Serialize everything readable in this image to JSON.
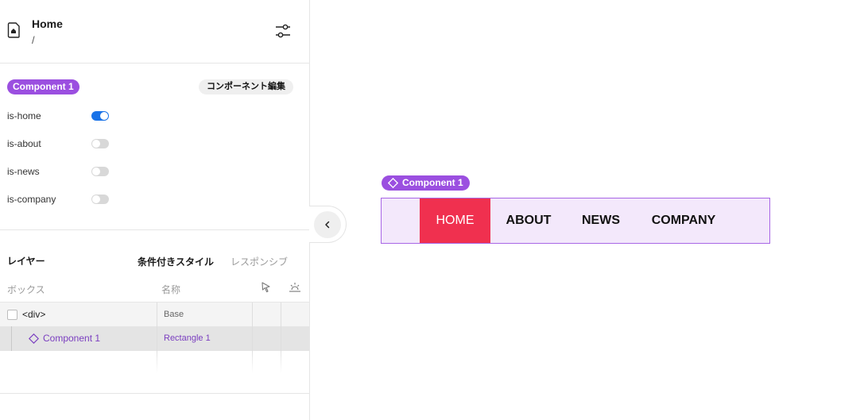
{
  "header": {
    "title": "Home",
    "path": "/"
  },
  "component": {
    "badge": "Component 1",
    "edit_label": "コンポーネント編集",
    "props": [
      {
        "label": "is-home",
        "on": true
      },
      {
        "label": "is-about",
        "on": false
      },
      {
        "label": "is-news",
        "on": false
      },
      {
        "label": "is-company",
        "on": false
      }
    ]
  },
  "layers": {
    "title": "レイヤー",
    "tab_conditional": "条件付きスタイル",
    "tab_responsive": "レスポンシブ",
    "col_box": "ボックス",
    "col_name": "名称",
    "rows": [
      {
        "name": "<div>",
        "value": "Base"
      },
      {
        "name": "Component 1",
        "value": "Rectangle 1"
      }
    ]
  },
  "canvas": {
    "badge": "Component 1",
    "nav_items": [
      "HOME",
      "ABOUT",
      "NEWS",
      "COMPANY"
    ],
    "active_item": "HOME"
  },
  "colors": {
    "accent_purple": "#9b4fe0",
    "active_red": "#f0304f",
    "toggle_on": "#1a73e8",
    "nav_bg": "#f3e8fb"
  }
}
